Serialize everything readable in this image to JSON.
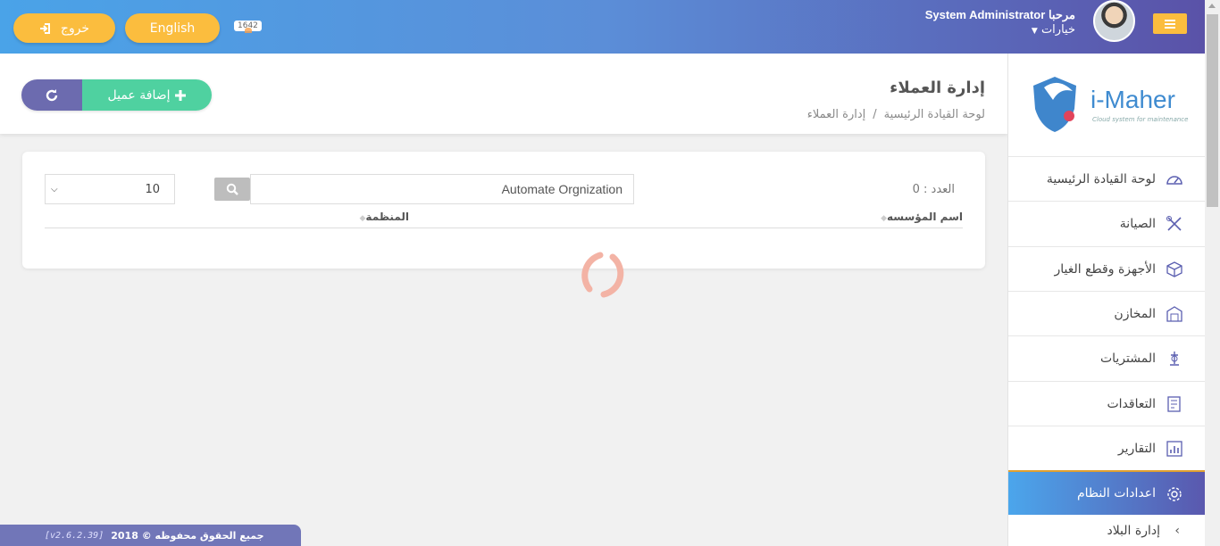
{
  "header": {
    "logout_label": "خروج",
    "language_label": "English",
    "notification_count": "1642",
    "welcome": "System Administrator مرحبا",
    "options_label": "خيارات"
  },
  "sidebar": {
    "logo_text": "i-Maher",
    "logo_subtitle": "Cloud system for maintenance",
    "items": [
      {
        "label": "لوحة القيادة الرئيسية",
        "icon": "dashboard-gauge-icon"
      },
      {
        "label": "الصيانة",
        "icon": "tools-icon"
      },
      {
        "label": "الأجهزة وقطع الغيار",
        "icon": "box-icon"
      },
      {
        "label": "المخازن",
        "icon": "warehouse-icon"
      },
      {
        "label": "المشتريات",
        "icon": "purchases-icon"
      },
      {
        "label": "التعاقدات",
        "icon": "contracts-icon"
      },
      {
        "label": "التقارير",
        "icon": "reports-icon"
      },
      {
        "label": "اعدادات النظام",
        "icon": "gear-icon",
        "active": true
      }
    ],
    "sub_item": "إدارة البلاد"
  },
  "page": {
    "title": "إدارة العملاء",
    "breadcrumb_home": "لوحة القيادة الرئيسية",
    "breadcrumb_sep": "/",
    "breadcrumb_current": "إدارة العملاء",
    "add_button": "إضافة عميل"
  },
  "table": {
    "count_label": "العدد : 0",
    "search_value": "Automate Orgnization",
    "page_size": "10",
    "columns": [
      "اسم المؤسسه",
      "المنظمة"
    ]
  },
  "footer": {
    "version": "[v2.6.2.39]",
    "copyright": "جميع الحقوق محفوظه © 2018"
  },
  "colors": {
    "accent_yellow": "#fbbd3e",
    "header_start": "#4aa3e8",
    "header_end": "#5a52a8",
    "add_green": "#4fd1a0",
    "refresh_purple": "#6c6baf"
  }
}
